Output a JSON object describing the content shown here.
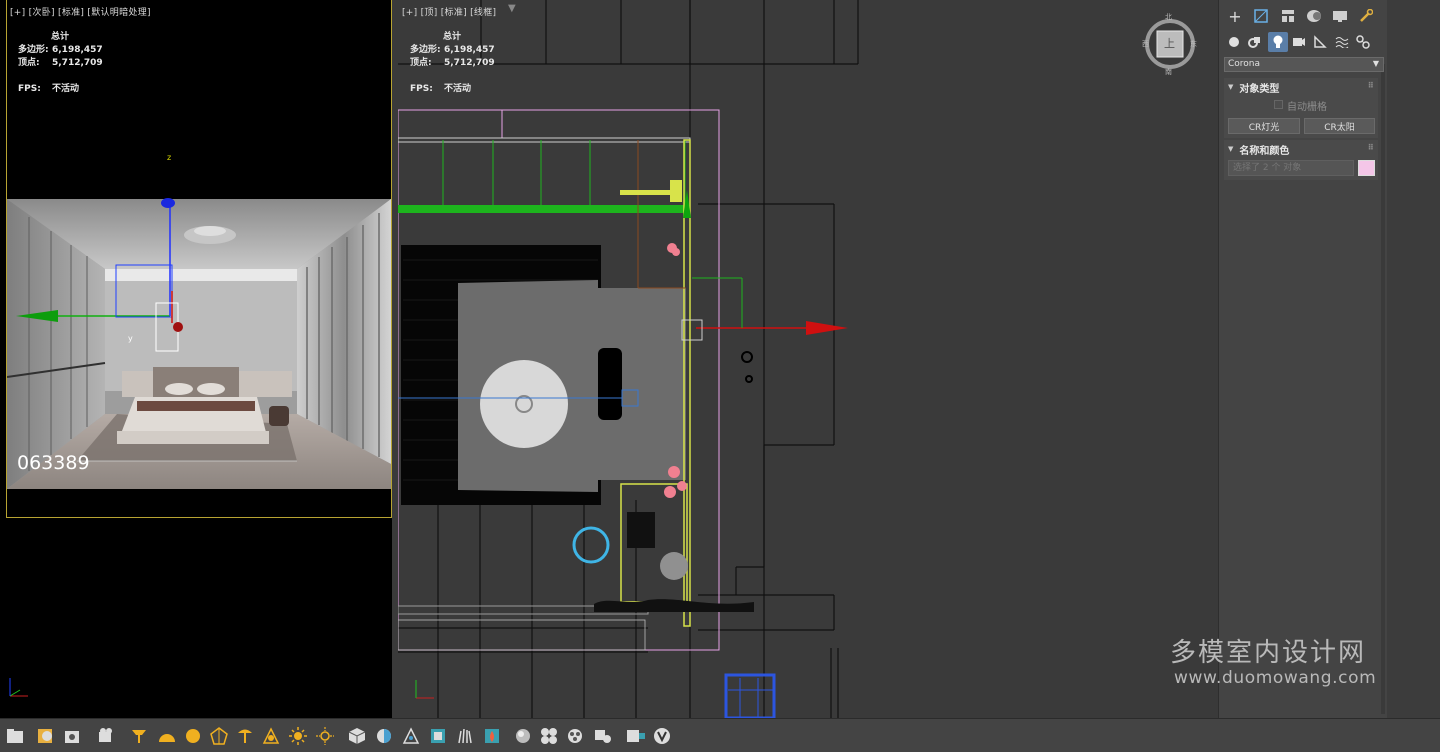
{
  "viewports": {
    "left": {
      "label": "[+] [次卧] [标准] [默认明暗处理]",
      "stats_title": "总计",
      "poly_label": "多边形:",
      "poly_value": "6,198,457",
      "vert_label": "顶点:",
      "vert_value": "5,712,709",
      "fps_label": "FPS:",
      "fps_value": "不活动",
      "render_id": "063389",
      "axis_z": "z",
      "axis_y": "y"
    },
    "right": {
      "label": "[+] [顶] [标准] [线框]",
      "stats_title": "总计",
      "poly_label": "多边形:",
      "poly_value": "6,198,457",
      "vert_label": "顶点:",
      "vert_value": "5,712,709",
      "fps_label": "FPS:",
      "fps_value": "不活动"
    }
  },
  "command_panel": {
    "tabs": [
      "create-icon",
      "modify-icon",
      "hierarchy-icon",
      "motion-icon",
      "display-icon",
      "utilities-icon"
    ],
    "subtabs": [
      "geometry-icon",
      "shapes-icon",
      "lights-icon",
      "cameras-icon",
      "helpers-icon",
      "spacewarps-icon",
      "systems-icon"
    ],
    "renderer_select": "Corona",
    "object_type": {
      "title": "对象类型",
      "autogrid": "自动栅格",
      "buttons": [
        "CR灯光",
        "CR太阳"
      ]
    },
    "name_color": {
      "title": "名称和颜色",
      "placeholder": "选择了 2 个 对象",
      "swatch_color": "#f4c6e8"
    }
  },
  "watermark": {
    "line1": "多模室内设计网",
    "line2": "www.duomowang.com"
  },
  "viewcube": {
    "north": "北",
    "south": "南",
    "west": "西",
    "east": "东",
    "face": "上"
  }
}
